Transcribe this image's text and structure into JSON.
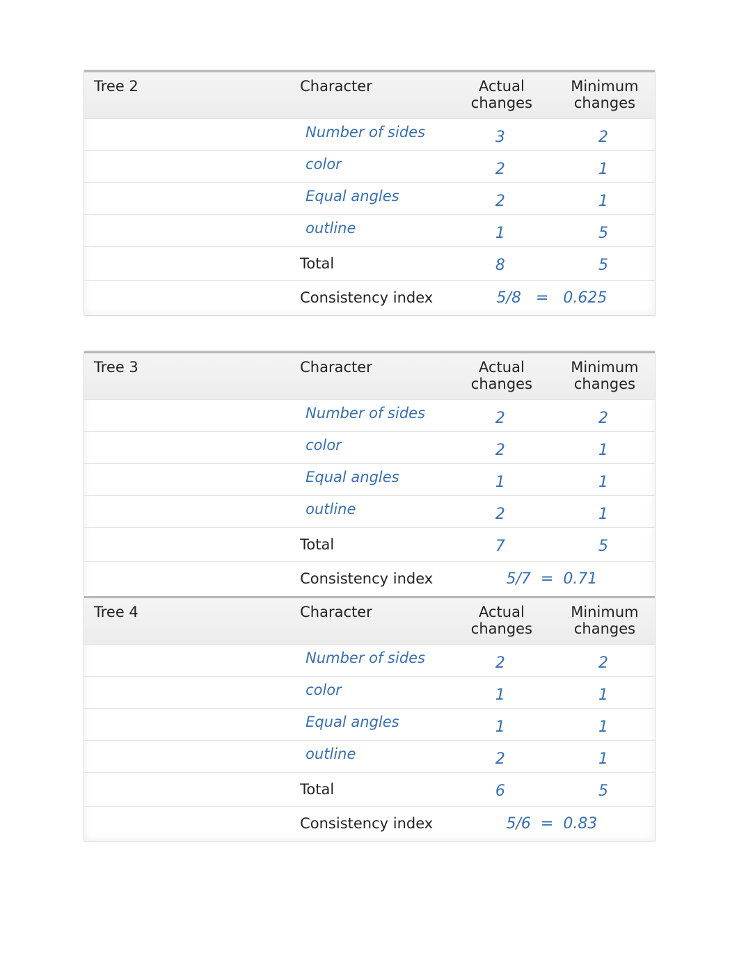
{
  "headers": {
    "character": "Character",
    "actual": "Actual changes",
    "minimum": "Minimum changes",
    "total": "Total",
    "ci": "Consistency index",
    "eq": "="
  },
  "tables": [
    {
      "tree": "Tree 2",
      "rows": [
        {
          "label": "Number of sides",
          "actual": "3",
          "min": "2"
        },
        {
          "label": "color",
          "actual": "2",
          "min": "1"
        },
        {
          "label": "Equal angles",
          "actual": "2",
          "min": "1"
        },
        {
          "label": "outline",
          "actual": "1",
          "min": "5"
        }
      ],
      "total_actual": "8",
      "total_min": "5",
      "ci_frac": "5/8",
      "ci_val": "0.625"
    },
    {
      "tree": "Tree 3",
      "rows": [
        {
          "label": "Number of sides",
          "actual": "2",
          "min": "2"
        },
        {
          "label": "color",
          "actual": "2",
          "min": "1"
        },
        {
          "label": "Equal angles",
          "actual": "1",
          "min": "1"
        },
        {
          "label": "outline",
          "actual": "2",
          "min": "1"
        }
      ],
      "total_actual": "7",
      "total_min": "5",
      "ci_frac": "5/7",
      "ci_val": "0.71"
    },
    {
      "tree": "Tree 4",
      "rows": [
        {
          "label": "Number of sides",
          "actual": "2",
          "min": "2"
        },
        {
          "label": "color",
          "actual": "1",
          "min": "1"
        },
        {
          "label": "Equal angles",
          "actual": "1",
          "min": "1"
        },
        {
          "label": "outline",
          "actual": "2",
          "min": "1"
        }
      ],
      "total_actual": "6",
      "total_min": "5",
      "ci_frac": "5/6",
      "ci_val": "0.83"
    }
  ]
}
